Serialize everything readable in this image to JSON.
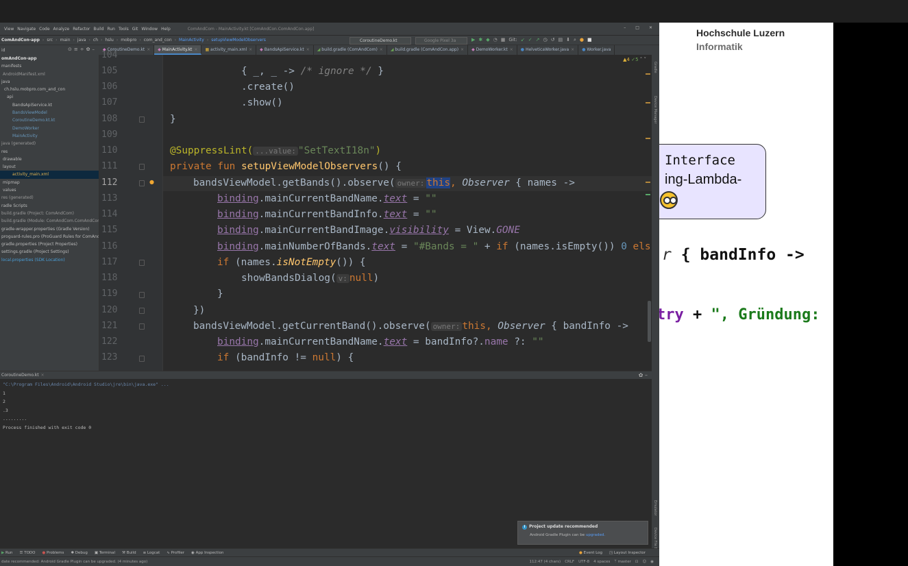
{
  "menubar": {
    "items": [
      "View",
      "Navigate",
      "Code",
      "Analyze",
      "Refactor",
      "Build",
      "Run",
      "Tools",
      "Git",
      "Window",
      "Help"
    ],
    "window_title": "ComAndCom - MainActivity.kt [ComAndCon.ComAndCon.app]"
  },
  "navbar": {
    "crumbs": [
      "ComAndCon-app",
      "src",
      "main",
      "java",
      "ch",
      "hslu",
      "mobpro",
      "com_and_con",
      "MainActivity",
      "setupViewModelObservers"
    ],
    "run_config": "CoroutineDemo.kt",
    "device": "Google Pixel 3a"
  },
  "project_header": "id",
  "file_tabs": [
    "CoroutineDemo.kt",
    "MainActivity.kt",
    "activity_main.xml",
    "BandsApiService.kt",
    "build.gradle (ComAndCom)",
    "build.gradle (ComAndCon.app)",
    "DemoWorker.kt",
    "HelveticaWorker.java",
    "Worker.java"
  ],
  "active_tab_index": 1,
  "project_tree": [
    {
      "label": "omAndCon-app",
      "kind": "mod"
    },
    {
      "label": "manifests",
      "kind": "dir"
    },
    {
      "label": "AndroidManifest.xml",
      "kind": "cfg"
    },
    {
      "label": "java",
      "kind": "dir"
    },
    {
      "label": "ch.hslu.mobpro.com_and_con",
      "kind": "dir"
    },
    {
      "label": "api",
      "kind": "dir"
    },
    {
      "label": "BandsApiService.kt",
      "kind": "file"
    },
    {
      "label": "BandsViewModel",
      "kind": "kfile"
    },
    {
      "label": "CoroutineDemo.kt.kt",
      "kind": "kfile"
    },
    {
      "label": "DemoWorker",
      "kind": "kfile"
    },
    {
      "label": "MainActivity",
      "kind": "kfile"
    },
    {
      "label": "java (generated)",
      "kind": "cfg"
    },
    {
      "label": "res",
      "kind": "dir"
    },
    {
      "label": "drawable",
      "kind": "dir"
    },
    {
      "label": "layout",
      "kind": "dir"
    },
    {
      "label": "activity_main.xml",
      "kind": "sel"
    },
    {
      "label": "mipmap",
      "kind": "dir"
    },
    {
      "label": "values",
      "kind": "dir"
    },
    {
      "label": "res (generated)",
      "kind": "cfg"
    },
    {
      "label": "radle Scripts",
      "kind": "dir"
    },
    {
      "label": "build.gradle (Project: ComAndCom)",
      "kind": "cfg"
    },
    {
      "label": "build.gradle (Module: ComAndCom.ComAndCon.app)",
      "kind": "cfg"
    },
    {
      "label": "gradle-wrapper.properties (Gradle Version)",
      "kind": "dir"
    },
    {
      "label": "proguard-rules.pro (ProGuard Rules for ComAndCon)",
      "kind": "dir"
    },
    {
      "label": "gradle.properties (Project Properties)",
      "kind": "dir"
    },
    {
      "label": "settings.gradle (Project Settings)",
      "kind": "dir"
    },
    {
      "label": "local.properties (SDK Location)",
      "kind": "hl"
    }
  ],
  "line_numbers": [
    "104",
    "105",
    "106",
    "107",
    "108",
    "109",
    "110",
    "111",
    "112",
    "113",
    "114",
    "115",
    "116",
    "117",
    "118",
    "119",
    "120",
    "121",
    "122",
    "123"
  ],
  "current_line": "112",
  "code": {
    "l105_a": "{ _, _ -> ",
    "l105_cmt": "/* ignore */",
    "l105_b": " }",
    "l106": ".create()",
    "l107": ".show()",
    "l108": "}",
    "l110_ann": "@SuppressLint(",
    "l110_hint": "...value:",
    "l110_str": "\"SetTextI18n\"",
    "l110_end": ")",
    "l111_kw": "private fun ",
    "l111_fn": "setupViewModelObservers",
    "l111_end": "() {",
    "l112_a": "bandsViewModel.getBands().observe(",
    "l112_hint": "owner:",
    "l112_this": "this",
    "l112_b": ", ",
    "l112_obs": "Observer",
    "l112_c": " { names ->",
    "l113_bind": "binding",
    "l113_a": ".mainCurrentBandName.",
    "l113_prop": "text",
    "l113_b": " = ",
    "l113_str": "\"\"",
    "l114_bind": "binding",
    "l114_a": ".mainCurrentBandInfo.",
    "l114_prop": "text",
    "l114_b": " = ",
    "l114_str": "\"\"",
    "l115_bind": "binding",
    "l115_a": ".mainCurrentBandImage.",
    "l115_prop": "visibility",
    "l115_b": " = View.",
    "l115_gone": "GONE",
    "l116_bind": "binding",
    "l116_a": ".mainNumberOfBands.",
    "l116_prop": "text",
    "l116_b": " = ",
    "l116_str": "\"#Bands = \"",
    "l116_c": " + ",
    "l116_if": "if",
    "l116_d": " (names.isEmpty()) ",
    "l116_num": "0",
    "l116_els": " els",
    "l117_if": "if",
    "l117_a": " (names.",
    "l117_fn": "isNotEmpty",
    "l117_b": "()) {",
    "l118_a": "showBandsDialog(",
    "l118_hint": "v:",
    "l118_null": "null",
    "l118_b": ")",
    "l119": "}",
    "l120": "})",
    "l121_a": "bandsViewModel.getCurrentBand().observe(",
    "l121_hint": "owner:",
    "l121_this": "this",
    "l121_b": ", ",
    "l121_obs": "Observer",
    "l121_c": " { bandInfo ->",
    "l122_bind": "binding",
    "l122_a": ".mainCurrentBandName.",
    "l122_prop": "text",
    "l122_b": " = bandInfo?.",
    "l122_name": "name",
    "l122_c": " ?: ",
    "l122_str": "\"\"",
    "l123_if": "if",
    "l123_a": " (bandInfo != ",
    "l123_null": "null",
    "l123_b": ") {"
  },
  "inspection": {
    "warnings": "▲4",
    "weak": "✓5"
  },
  "run_panel": {
    "tab": "CoroutineDemo.kt",
    "lines": [
      "\"C:\\Program Files\\Android\\Android Studio\\jre\\bin\\java.exe\" ...",
      "1",
      "2",
      ".3",
      ".........",
      "Process finished with exit code 0"
    ]
  },
  "notification": {
    "title": "Project update recommended",
    "body": "Android Gradle Plugin can be ",
    "link": "upgraded."
  },
  "tool_windows": {
    "left": [
      "Run",
      "TODO",
      "Problems",
      "Debug",
      "Terminal",
      "Build",
      "Logcat",
      "Profiler",
      "App Inspection"
    ],
    "right": [
      "Event Log",
      "Layout Inspector"
    ]
  },
  "statusbar": {
    "message": "date recommended: Android Gradle Plugin can be upgraded. (4 minutes ago)",
    "position": "112:47 (4 chars)",
    "line_sep": "CRLF",
    "encoding": "UTF-8",
    "indent": "4 spaces",
    "branch": "master"
  },
  "slide": {
    "org_line1": "Hochschule Luzern",
    "org_line2": "Informatik",
    "callout_line1": "Interface",
    "callout_line2": "ing-Lambda-",
    "code1_a": "r",
    "code1_b": " { bandInfo ->",
    "code2_a": "try",
    "code2_b": " + ",
    "code2_c": "\", Gründung:"
  }
}
